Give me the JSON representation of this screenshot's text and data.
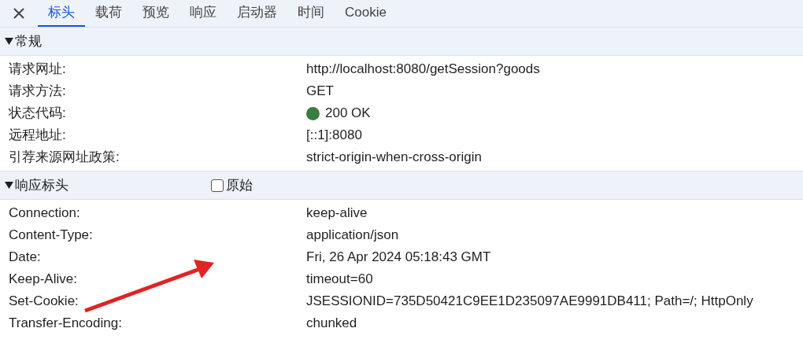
{
  "tabs": [
    {
      "label": "标头",
      "selected": true
    },
    {
      "label": "载荷",
      "selected": false
    },
    {
      "label": "预览",
      "selected": false
    },
    {
      "label": "响应",
      "selected": false
    },
    {
      "label": "启动器",
      "selected": false
    },
    {
      "label": "时间",
      "selected": false
    },
    {
      "label": "Cookie",
      "selected": false
    }
  ],
  "sections": [
    {
      "title": "常规",
      "expanded": true,
      "rows": [
        {
          "name": "请求网址:",
          "value": "http://localhost:8080/getSession?goods"
        },
        {
          "name": "请求方法:",
          "value": "GET"
        },
        {
          "name": "状态代码:",
          "value": "200 OK",
          "color": "#3b7d3f"
        },
        {
          "name": "远程地址:",
          "value": "[::1]:8080"
        },
        {
          "name": "引荐来源网址政策:",
          "value": "strict-origin-when-cross-origin"
        }
      ]
    },
    {
      "title": "响应标头",
      "expanded": true,
      "raw": {
        "label": "原始",
        "checked": false
      },
      "rows": [
        {
          "name": "Connection:",
          "value": "keep-alive"
        },
        {
          "name": "Content-Type:",
          "value": "application/json"
        },
        {
          "name": "Date:",
          "value": "Fri, 26 Apr 2024 05:18:43 GMT"
        },
        {
          "name": "Keep-Alive:",
          "value": "timeout=60"
        },
        {
          "name": "Set-Cookie:",
          "value": "JSESSIONID=735D50421C9EE1D235097AE9991DB411; Path=/; HttpOnly"
        },
        {
          "name": "Transfer-Encoding:",
          "value": "chunked"
        }
      ]
    }
  ]
}
